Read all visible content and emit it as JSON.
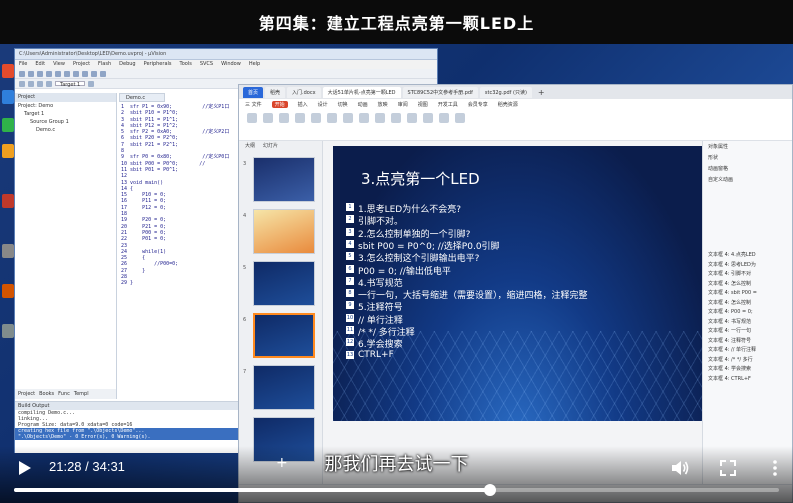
{
  "video_title": "第四集：建立工程点亮第一颗LED上",
  "subtitle": "那我们再去试一下",
  "player": {
    "time_display": "21:28 / 34:31",
    "progress_fraction": 0.622,
    "icons": [
      "play-icon",
      "volume-icon",
      "fullscreen-icon",
      "more-vert-icon"
    ]
  },
  "keil": {
    "title": "C:\\Users\\Administrator\\Desktop\\LED\\Demo.uvproj - µVision",
    "menu": [
      "File",
      "Edit",
      "View",
      "Project",
      "Flash",
      "Debug",
      "Peripherals",
      "Tools",
      "SVCS",
      "Window",
      "Help"
    ],
    "target": "Target 1",
    "project_header": "Project",
    "project_tree": [
      "Project: Demo",
      "Target 1",
      "Source Group 1",
      "Demo.c"
    ],
    "project_tabs": [
      "Project",
      "Books",
      "Func",
      "Templ"
    ],
    "editor_tab": "Demo.c",
    "code_lines": [
      "1  sfr P1 = 0x90;          //定义P1口",
      "2  sbit P10 = P1^0;",
      "3  sbit P11 = P1^1;",
      "4  sbit P12 = P1^2;",
      "5  sfr P2 = 0xA0;          //定义P2口",
      "6  sbit P20 = P2^0;",
      "7  sbit P21 = P2^1;",
      "8",
      "9  sfr P0 = 0x80;          //定义P0口",
      "10 sbit P00 = P0^0;       //",
      "11 sbit P01 = P0^1;",
      "12",
      "13 void main()",
      "14 {",
      "15     P10 = 0;",
      "16     P11 = 0;",
      "17     P12 = 0;",
      "18",
      "19     P20 = 0;",
      "20     P21 = 0;",
      "21     P00 = 0;",
      "22     P01 = 0;",
      "23",
      "24     while(1)",
      "25     {",
      "26         //P00=0;",
      "27     }",
      "28",
      "29 }"
    ],
    "build_header": "Build Output",
    "build_lines": [
      "compiling Demo.c...",
      "linking...",
      "Program Size: data=9.0 xdata=0 code=16",
      "creating hex file from \".\\Objects\\Demo\"...",
      "\".\\Objects\\Demo\" - 0 Error(s), 0 Warning(s)."
    ]
  },
  "wps": {
    "tabs": [
      "首页",
      "稻壳",
      "入门.docx",
      "大话51单片机-点亮第一颗LED",
      "STC89C52中文参考手册.pdf",
      "stc32g.pdf (只读)"
    ],
    "menu": [
      "三 文件",
      "开始",
      "插入",
      "设计",
      "切换",
      "动画",
      "放映",
      "审阅",
      "视图",
      "开发工具",
      "会员专享",
      "稻壳资源"
    ],
    "thumb_tabs": [
      "大纲",
      "幻灯片"
    ],
    "slide_numbers": [
      "3",
      "4",
      "5",
      "6",
      "7"
    ],
    "selected_slide_index": 3,
    "slide": {
      "title": "3.点亮第一个LED",
      "lines": [
        {
          "num": "1",
          "text": "1.思考LED为什么不会亮?"
        },
        {
          "num": "2",
          "text": "   引脚不对。"
        },
        {
          "num": "3",
          "text": "2.怎么控制单独的一个引脚?"
        },
        {
          "num": "4",
          "text": "   sbit P00 = P0^0;        //选择P0.0引脚"
        },
        {
          "num": "5",
          "text": "3.怎么控制这个引脚输出电平?"
        },
        {
          "num": "6",
          "text": "   P00 = 0;        //输出低电平"
        },
        {
          "num": "7",
          "text": "4.书写规范"
        },
        {
          "num": "8",
          "text": "   一行一句，大括号缩进（需要设置），缩进四格，注释完整"
        },
        {
          "num": "9",
          "text": "5.注释符号"
        },
        {
          "num": "10",
          "text": "   //  单行注释"
        },
        {
          "num": "11",
          "text": "   /*  */  多行注释"
        },
        {
          "num": "12",
          "text": "6.学会搜索"
        },
        {
          "num": "13",
          "text": "   CTRL+F"
        }
      ]
    },
    "right_pane": {
      "items": [
        "对象属性",
        "形状",
        "动画窗格",
        "自定义动画"
      ],
      "list": [
        "文本框 4: 4.点亮LED",
        "文本框 4: 思考LED为",
        "文本框 4: 引脚不对",
        "文本框 4: 怎么控制",
        "文本框 4: sbit P00 =",
        "文本框 4: 怎么控制",
        "文本框 4: P00 = 0;",
        "文本框 4: 书写规范",
        "文本框 4: 一行一句",
        "文本框 4: 注释符号",
        "文本框 4: // 单行注释",
        "文本框 4: /* */ 多行",
        "文本框 4: 学会搜索",
        "文本框 4: CTRL+F"
      ]
    }
  }
}
